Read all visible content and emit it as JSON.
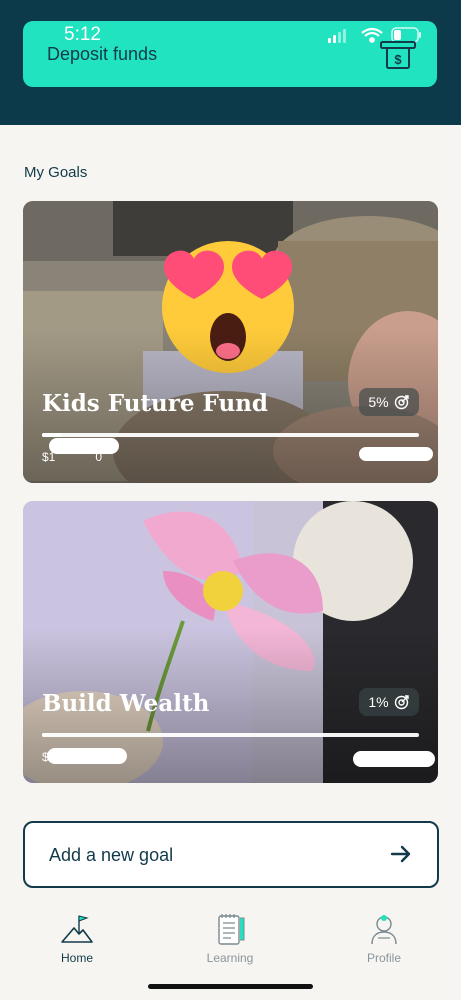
{
  "status_bar": {
    "time": "5:12"
  },
  "deposit": {
    "label": "Deposit funds",
    "icon": "atm-cash-icon"
  },
  "goals_section": {
    "title": "My Goals"
  },
  "goals": [
    {
      "name": "Kids Future Fund",
      "percent_label": "5%",
      "progress": 0.05,
      "amount_left": "$1",
      "amount_suffix": "0",
      "image": "baby-outdoors-photo"
    },
    {
      "name": "Build Wealth",
      "percent_label": "1%",
      "progress": 0.01,
      "amount_left": "$1",
      "image": "pink-flower-photo"
    }
  ],
  "add_goal": {
    "label": "Add a new goal",
    "icon": "arrow-right-icon"
  },
  "tabs": [
    {
      "label": "Home",
      "icon": "mountain-flag-icon",
      "active": true
    },
    {
      "label": "Learning",
      "icon": "notebook-icon",
      "active": false
    },
    {
      "label": "Profile",
      "icon": "person-icon",
      "active": false
    }
  ],
  "colors": {
    "accent": "#21e3c0",
    "navy": "#0d3a4b",
    "text": "#123a4a"
  }
}
